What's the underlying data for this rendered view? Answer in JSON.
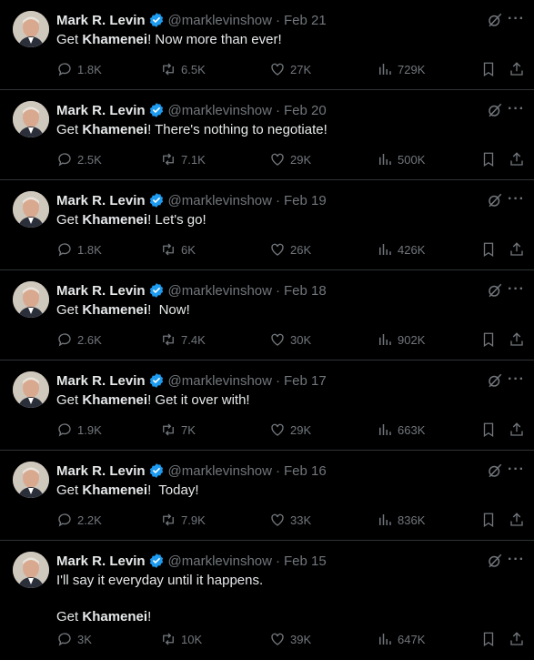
{
  "tweets": [
    {
      "name": "Mark R. Levin",
      "handle": "@marklevinshow",
      "separator": "·",
      "date": "Feb 21",
      "text_before": "Get ",
      "text_bold": "Khamenei",
      "text_after": "! Now more than ever!",
      "replies": "1.8K",
      "reposts": "6.5K",
      "likes": "27K",
      "views": "729K"
    },
    {
      "name": "Mark R. Levin",
      "handle": "@marklevinshow",
      "separator": "·",
      "date": "Feb 20",
      "text_before": "Get ",
      "text_bold": "Khamenei",
      "text_after": "! There's nothing to negotiate!",
      "replies": "2.5K",
      "reposts": "7.1K",
      "likes": "29K",
      "views": "500K"
    },
    {
      "name": "Mark R. Levin",
      "handle": "@marklevinshow",
      "separator": "·",
      "date": "Feb 19",
      "text_before": "Get ",
      "text_bold": "Khamenei",
      "text_after": "! Let's go!",
      "replies": "1.8K",
      "reposts": "6K",
      "likes": "26K",
      "views": "426K"
    },
    {
      "name": "Mark R. Levin",
      "handle": "@marklevinshow",
      "separator": "·",
      "date": "Feb 18",
      "text_before": "Get ",
      "text_bold": "Khamenei",
      "text_after": "!  Now!",
      "replies": "2.6K",
      "reposts": "7.4K",
      "likes": "30K",
      "views": "902K"
    },
    {
      "name": "Mark R. Levin",
      "handle": "@marklevinshow",
      "separator": "·",
      "date": "Feb 17",
      "text_before": "Get ",
      "text_bold": "Khamenei",
      "text_after": "! Get it over with!",
      "replies": "1.9K",
      "reposts": "7K",
      "likes": "29K",
      "views": "663K"
    },
    {
      "name": "Mark R. Levin",
      "handle": "@marklevinshow",
      "separator": "·",
      "date": "Feb 16",
      "text_before": "Get ",
      "text_bold": "Khamenei",
      "text_after": "!  Today!",
      "replies": "2.2K",
      "reposts": "7.9K",
      "likes": "33K",
      "views": "836K"
    },
    {
      "name": "Mark R. Levin",
      "handle": "@marklevinshow",
      "separator": "·",
      "date": "Feb 15",
      "text_before": "I'll say it everyday until it happens.\n\nGet ",
      "text_bold": "Khamenei",
      "text_after": "!",
      "replies": "3K",
      "reposts": "10K",
      "likes": "39K",
      "views": "647K"
    }
  ],
  "icons": {
    "verified": "verified-badge-icon",
    "grok": "grok-icon",
    "more": "more-icon",
    "reply": "reply-icon",
    "repost": "repost-icon",
    "like": "like-icon",
    "views": "views-icon",
    "bookmark": "bookmark-icon",
    "share": "share-icon"
  },
  "more_glyph": "···",
  "colors": {
    "background": "#000000",
    "text": "#e7e9ea",
    "secondary": "#71767b",
    "verified": "#1d9bf0",
    "divider": "#2f3336"
  }
}
